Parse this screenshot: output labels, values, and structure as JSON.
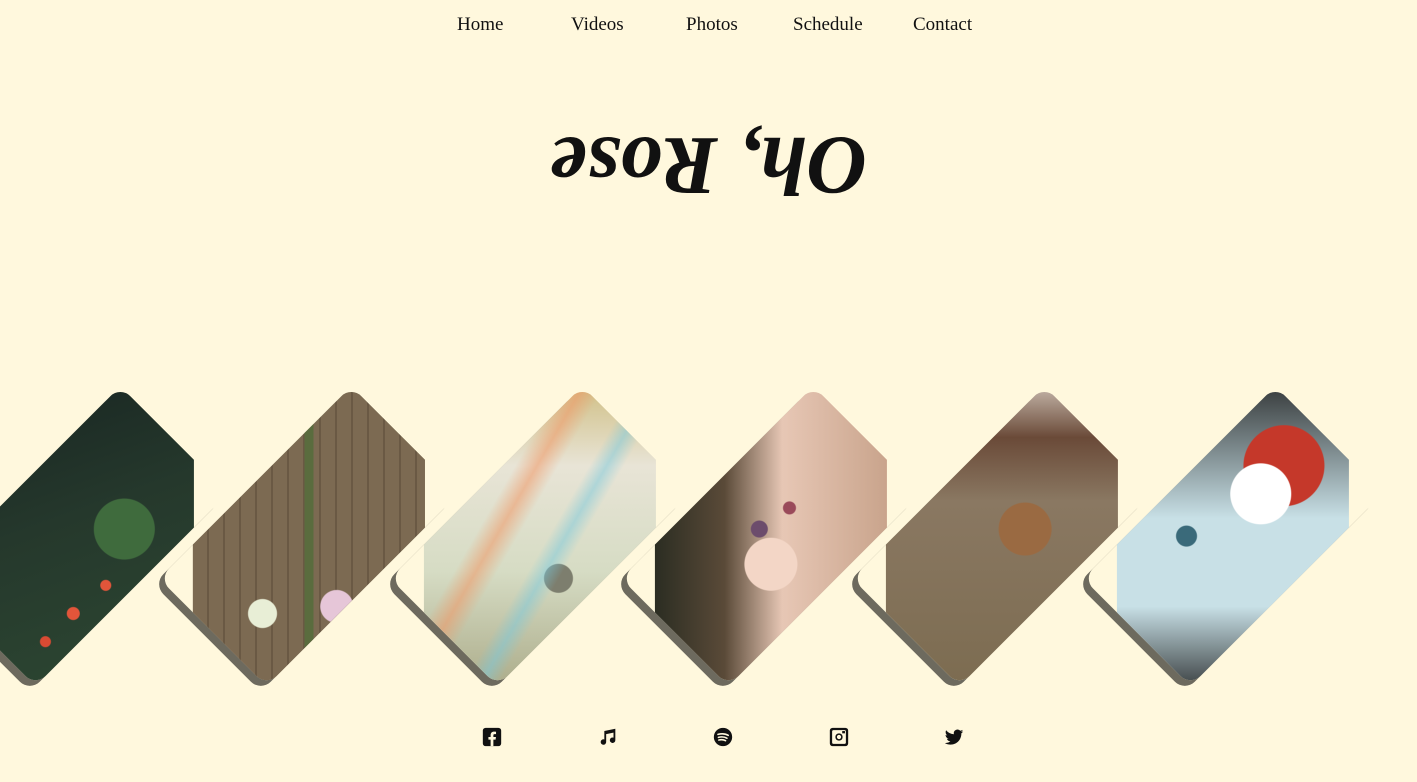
{
  "nav": {
    "items": [
      {
        "label": "Home"
      },
      {
        "label": "Videos"
      },
      {
        "label": "Photos"
      },
      {
        "label": "Schedule"
      },
      {
        "label": "Contact"
      }
    ]
  },
  "header": {
    "title": "Oh, Rose"
  },
  "gallery": {
    "tiles": [
      {
        "image": "red-roses-bush-photo"
      },
      {
        "image": "two-people-holding-flowers-by-fence-photo"
      },
      {
        "image": "iridescent-bedroom-legs-up-photo"
      },
      {
        "image": "face-paint-flowers-portrait-photo"
      },
      {
        "image": "curly-hair-mirror-photo"
      },
      {
        "image": "kiss-face-paint-illustration"
      }
    ]
  },
  "footer": {
    "icons": [
      {
        "name": "facebook-icon"
      },
      {
        "name": "music-note-icon"
      },
      {
        "name": "spotify-icon"
      },
      {
        "name": "instagram-icon"
      },
      {
        "name": "twitter-icon"
      }
    ]
  },
  "colors": {
    "background": "#fff8dd",
    "text": "#111111",
    "tile_shadow": "#6d6a5e"
  }
}
